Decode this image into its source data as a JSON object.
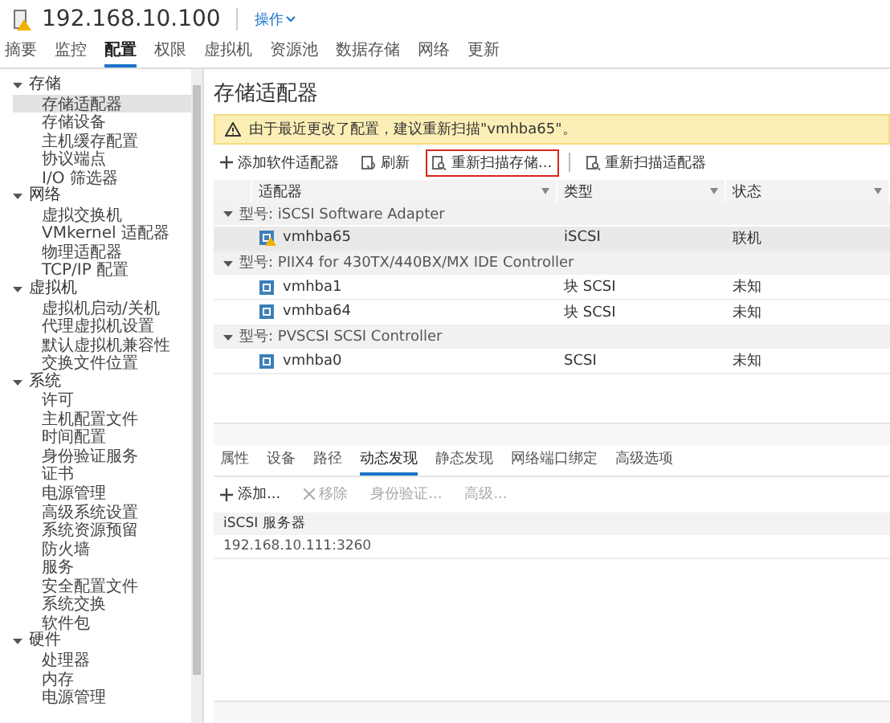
{
  "header": {
    "host": "192.168.10.100",
    "actions": "操作"
  },
  "tabs": [
    {
      "label": "摘要",
      "selected": false
    },
    {
      "label": "监控",
      "selected": false
    },
    {
      "label": "配置",
      "selected": true
    },
    {
      "label": "权限",
      "selected": false
    },
    {
      "label": "虚拟机",
      "selected": false
    },
    {
      "label": "资源池",
      "selected": false
    },
    {
      "label": "数据存储",
      "selected": false
    },
    {
      "label": "网络",
      "selected": false
    },
    {
      "label": "更新",
      "selected": false
    }
  ],
  "sidebar": {
    "groups": [
      {
        "label": "存储",
        "expanded": true,
        "children": [
          {
            "label": "存储适配器",
            "selected": true
          },
          {
            "label": "存储设备",
            "selected": false
          },
          {
            "label": "主机缓存配置",
            "selected": false
          },
          {
            "label": "协议端点",
            "selected": false
          },
          {
            "label": "I/O 筛选器",
            "selected": false
          }
        ]
      },
      {
        "label": "网络",
        "expanded": true,
        "children": [
          {
            "label": "虚拟交换机",
            "selected": false
          },
          {
            "label": "VMkernel 适配器",
            "selected": false
          },
          {
            "label": "物理适配器",
            "selected": false
          },
          {
            "label": "TCP/IP 配置",
            "selected": false
          }
        ]
      },
      {
        "label": "虚拟机",
        "expanded": true,
        "children": [
          {
            "label": "虚拟机启动/关机",
            "selected": false
          },
          {
            "label": "代理虚拟机设置",
            "selected": false
          },
          {
            "label": "默认虚拟机兼容性",
            "selected": false
          },
          {
            "label": "交换文件位置",
            "selected": false
          }
        ]
      },
      {
        "label": "系统",
        "expanded": true,
        "children": [
          {
            "label": "许可",
            "selected": false
          },
          {
            "label": "主机配置文件",
            "selected": false
          },
          {
            "label": "时间配置",
            "selected": false
          },
          {
            "label": "身份验证服务",
            "selected": false
          },
          {
            "label": "证书",
            "selected": false
          },
          {
            "label": "电源管理",
            "selected": false
          },
          {
            "label": "高级系统设置",
            "selected": false
          },
          {
            "label": "系统资源预留",
            "selected": false
          },
          {
            "label": "防火墙",
            "selected": false
          },
          {
            "label": "服务",
            "selected": false
          },
          {
            "label": "安全配置文件",
            "selected": false
          },
          {
            "label": "系统交换",
            "selected": false
          },
          {
            "label": "软件包",
            "selected": false
          }
        ]
      },
      {
        "label": "硬件",
        "expanded": true,
        "children": [
          {
            "label": "处理器",
            "selected": false
          },
          {
            "label": "内存",
            "selected": false
          },
          {
            "label": "电源管理",
            "selected": false
          }
        ]
      }
    ]
  },
  "main": {
    "title": "存储适配器",
    "warning": "由于最近更改了配置，建议重新扫描\"vmhba65\"。",
    "toolbar": [
      {
        "kind": "add",
        "label": "添加软件适配器",
        "highlighted": false
      },
      {
        "kind": "refresh",
        "label": "刷新",
        "highlighted": false
      },
      {
        "kind": "rescan",
        "label": "重新扫描存储...",
        "highlighted": true
      },
      {
        "kind": "rescan",
        "label": "重新扫描适配器",
        "highlighted": false
      }
    ],
    "table": {
      "columns": [
        "适配器",
        "类型",
        "状态"
      ],
      "groups": [
        {
          "label": "型号: iSCSI Software Adapter",
          "expanded": true,
          "rows": [
            {
              "adapter": "vmhba65",
              "type": "iSCSI",
              "status": "联机",
              "warning": true,
              "selected": true
            }
          ]
        },
        {
          "label": "型号: PIIX4 for 430TX/440BX/MX IDE Controller",
          "expanded": true,
          "rows": [
            {
              "adapter": "vmhba1",
              "type": "块 SCSI",
              "status": "未知",
              "warning": false,
              "selected": false
            },
            {
              "adapter": "vmhba64",
              "type": "块 SCSI",
              "status": "未知",
              "warning": false,
              "selected": false
            }
          ]
        },
        {
          "label": "型号: PVSCSI SCSI Controller",
          "expanded": true,
          "rows": [
            {
              "adapter": "vmhba0",
              "type": "SCSI",
              "status": "未知",
              "warning": false,
              "selected": false
            }
          ]
        }
      ]
    }
  },
  "details": {
    "tabs": [
      {
        "label": "属性",
        "selected": false
      },
      {
        "label": "设备",
        "selected": false
      },
      {
        "label": "路径",
        "selected": false
      },
      {
        "label": "动态发现",
        "selected": true
      },
      {
        "label": "静态发现",
        "selected": false
      },
      {
        "label": "网络端口绑定",
        "selected": false
      },
      {
        "label": "高级选项",
        "selected": false
      }
    ],
    "toolbar": [
      {
        "kind": "add",
        "label": "添加...",
        "disabled": false
      },
      {
        "kind": "remove",
        "label": "移除",
        "disabled": true
      },
      {
        "kind": "plain",
        "label": "身份验证...",
        "disabled": true
      },
      {
        "kind": "plain",
        "label": "高级...",
        "disabled": true
      }
    ],
    "table": {
      "columns": [
        "iSCSI 服务器"
      ],
      "rows": [
        "192.168.10.111:3260"
      ]
    }
  }
}
